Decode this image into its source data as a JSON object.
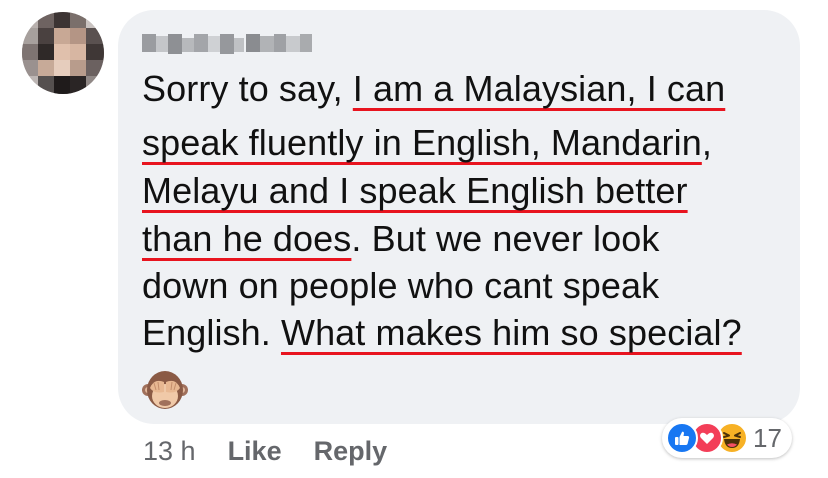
{
  "comment": {
    "author": "Ogunde Offa",
    "lines": [
      {
        "segments": [
          {
            "text": "Sorry to say, ",
            "u": false
          },
          {
            "text": "I am a Malaysian, I can",
            "u": true
          }
        ]
      },
      {
        "segments": [
          {
            "text": "speak fluently in English, Mandarin",
            "u": true
          },
          {
            "text": ",",
            "u": false
          }
        ]
      },
      {
        "segments": [
          {
            "text": "Melayu and I speak English better",
            "u": true
          }
        ]
      },
      {
        "segments": [
          {
            "text": "than he does",
            "u": true
          },
          {
            "text": ". But we never look",
            "u": false
          }
        ]
      },
      {
        "segments": [
          {
            "text": "down on people who cant speak",
            "u": false
          }
        ]
      },
      {
        "segments": [
          {
            "text": "English. ",
            "u": false
          },
          {
            "text": "What makes him so special?",
            "u": true
          }
        ]
      }
    ],
    "emoji": "see-no-evil-monkey"
  },
  "actions": {
    "time": "13 h",
    "like_label": "Like",
    "reply_label": "Reply"
  },
  "reactions": {
    "icons": [
      "like",
      "love",
      "haha"
    ],
    "count": "17"
  },
  "colors": {
    "bubble": "#eff1f4",
    "underline": "#e8141f",
    "like_blue": "#1877f2",
    "love_red": "#f33e58",
    "haha_yellow": "#f7b125",
    "meta_gray": "#65676b"
  }
}
